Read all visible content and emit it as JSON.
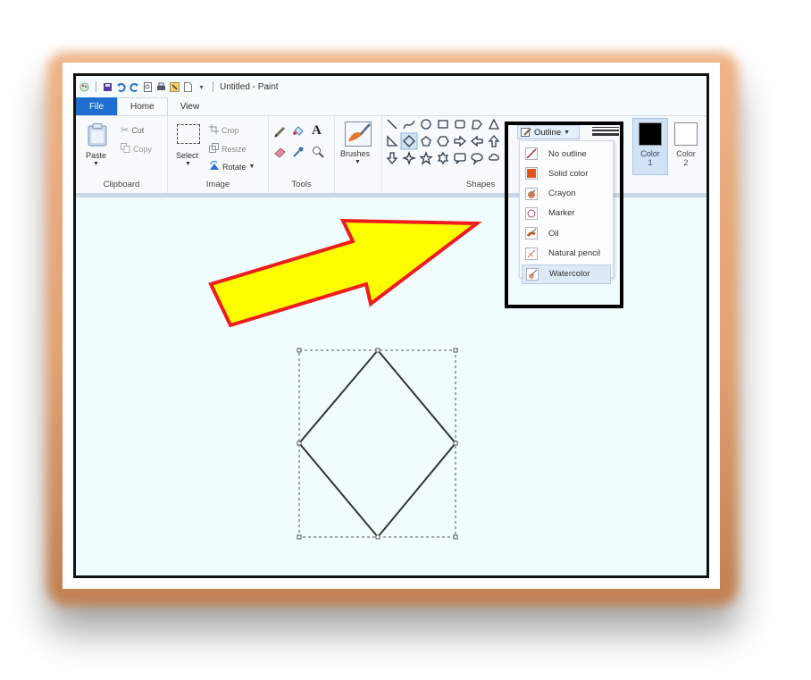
{
  "window": {
    "title": "Untitled - Paint",
    "quick_access_icons": [
      "paint-app-icon",
      "save-icon",
      "undo-icon",
      "redo-icon",
      "print-preview-icon",
      "print-icon",
      "image-properties-icon",
      "new-icon",
      "customize-dropdown-icon"
    ]
  },
  "tabs": [
    {
      "label": "File"
    },
    {
      "label": "Home"
    },
    {
      "label": "View"
    }
  ],
  "ribbon": {
    "clipboard": {
      "label": "Clipboard",
      "paste": "Paste",
      "cut": "Cut",
      "copy": "Copy"
    },
    "image": {
      "label": "Image",
      "select": "Select",
      "crop": "Crop",
      "resize": "Resize",
      "rotate": "Rotate"
    },
    "tools": {
      "label": "Tools"
    },
    "brushes": {
      "label": "Brushes"
    },
    "shapes": {
      "label": "Shapes",
      "selected_shape": "diamond",
      "outline_label": "Outline"
    },
    "colors": {
      "color1_label": "Color",
      "color1_num": "1",
      "color1_value": "#000000",
      "color2_label": "Color",
      "color2_num": "2",
      "color2_value": "#ffffff"
    }
  },
  "outline_menu": {
    "items": [
      {
        "label": "No outline"
      },
      {
        "label": "Solid color"
      },
      {
        "label": "Crayon"
      },
      {
        "label": "Marker"
      },
      {
        "label": "Oil"
      },
      {
        "label": "Natural pencil"
      },
      {
        "label": "Watercolor",
        "selected": true
      }
    ]
  },
  "annotation": {
    "arrow_fill": "#ffff00",
    "arrow_stroke": "#ee1c1c",
    "highlight_box_color": "#000000"
  },
  "accent": "#1e6fd0"
}
